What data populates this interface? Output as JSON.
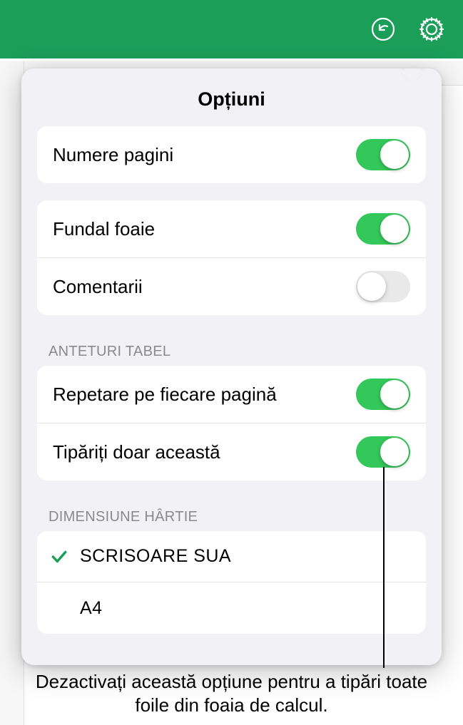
{
  "popover": {
    "title": "Opțiuni"
  },
  "toggles": {
    "page_numbers": {
      "label": "Numere pagini",
      "on": true
    },
    "sheet_background": {
      "label": "Fundal foaie",
      "on": true
    },
    "comments": {
      "label": "Comentarii",
      "on": false
    }
  },
  "section_headers": {
    "table_headers": "ANTETURI TABEL",
    "paper_size": "DIMENSIUNE HÂRTIE"
  },
  "table_headers_toggles": {
    "repeat_each_page": {
      "label": "Repetare pe fiecare pagină",
      "on": true
    },
    "print_only_this": {
      "label": "Tipăriți doar această",
      "on": true
    }
  },
  "paper_sizes": [
    {
      "label": "SCRISOARE SUA",
      "checked": true
    },
    {
      "label": "A4",
      "checked": false
    }
  ],
  "callout": "Dezactivați această opțiune pentru a tipări toate foile din foaia de calcul."
}
